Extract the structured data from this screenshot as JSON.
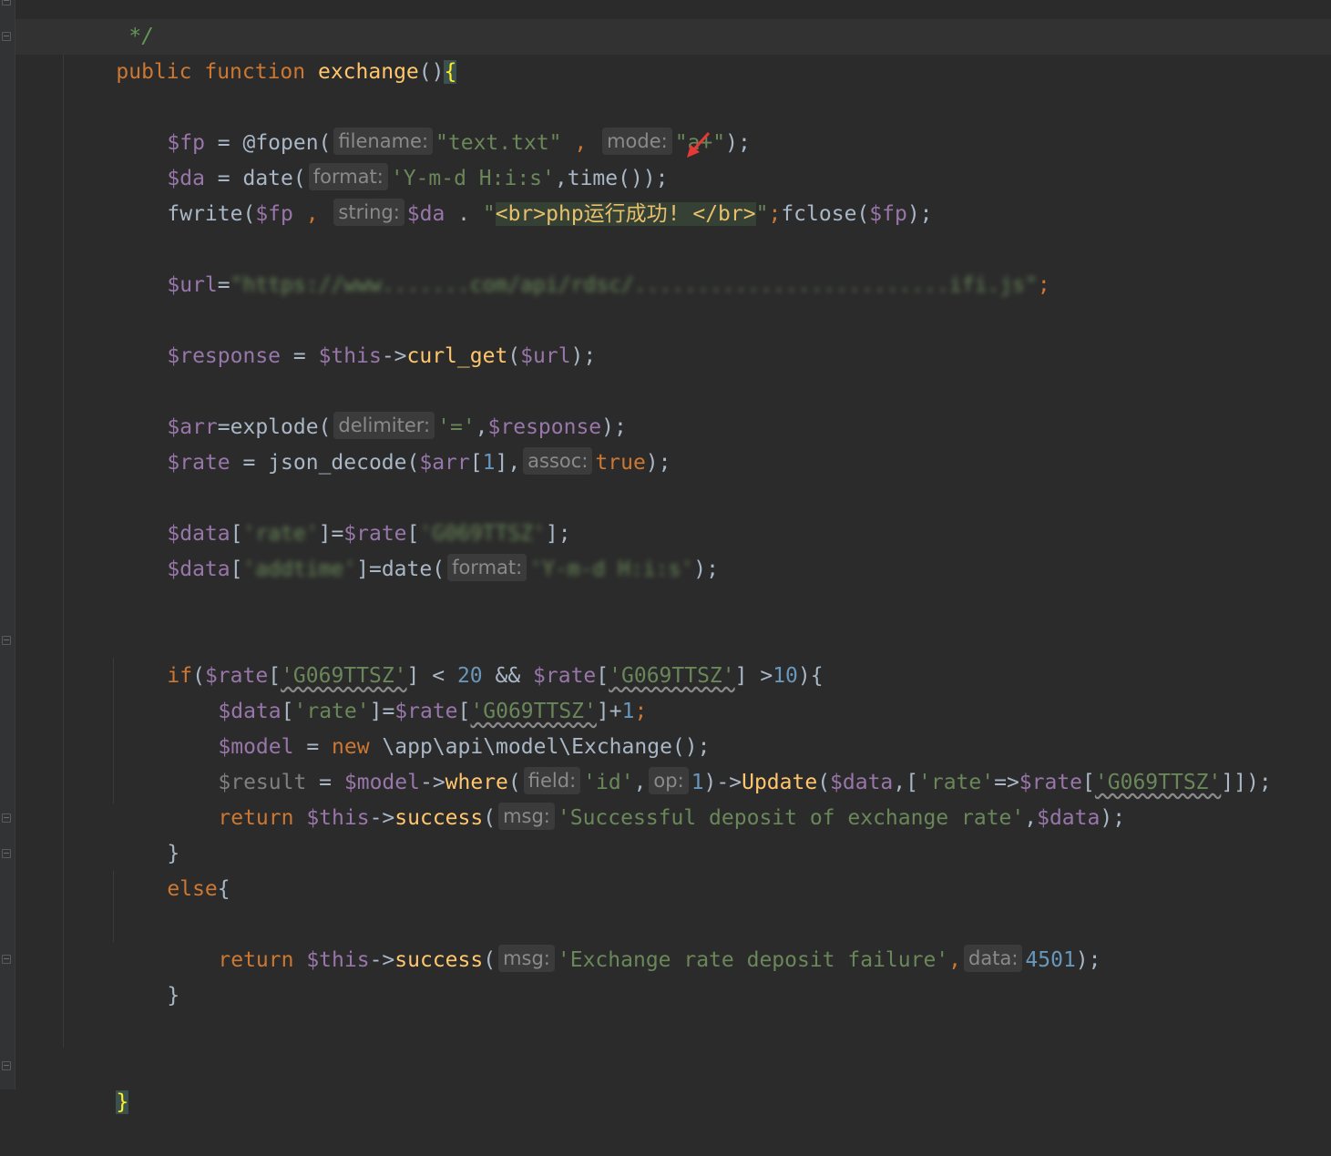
{
  "comment_tail": "*/",
  "func": {
    "kw1": "public",
    "kw2": "function",
    "name": "exchange",
    "open": "(){",
    "close": "}"
  },
  "hints": {
    "filename": "filename:",
    "mode": "mode:",
    "format": "format:",
    "string": "string:",
    "delimiter": "delimiter:",
    "assoc": "assoc:",
    "field": "field:",
    "op": "op:",
    "msg": "msg:",
    "data": "data:"
  },
  "l_fopen": {
    "var": "$fp",
    "eq": " = @fopen(",
    "a1": "\"text.txt\"",
    "sep": " , ",
    "a2": "\"a+\"",
    "end": ");"
  },
  "l_date": {
    "var": "$da",
    "eq": " = date(",
    "a1": "'Y-m-d H:i:s'",
    "mid": ",time());"
  },
  "l_fwrite": {
    "fn": "fwrite(",
    "v1": "$fp",
    "sep": " , ",
    "v2": "$da",
    "dot": " . ",
    "q1": "\"",
    "html": "<br>php运行成功! </br>",
    "q2": "\"",
    "end": ");fclose(",
    "v3": "$fp",
    "end2": ");"
  },
  "l_url": {
    "var": "$url",
    "eq": "=",
    "str": "\"https://www.......com/api/rdsc/.........................ifi.js\"",
    "end": ";"
  },
  "l_response": {
    "var": "$response",
    "eq": " = ",
    "this": "$this",
    "arrow": "->",
    "fn": "curl_get",
    "open": "(",
    "arg": "$url",
    "end": ");"
  },
  "l_explode": {
    "var": "$arr",
    "eq": "=explode(",
    "a1": "'='",
    "comma": ",",
    "a2": "$response",
    "end": ");"
  },
  "l_json": {
    "var": "$rate",
    "eq": " = json_decode(",
    "a1": "$arr",
    "idx": "[",
    "num": "1",
    "idx2": "],",
    "val": "true",
    "end": ");"
  },
  "l_data1": {
    "var": "$data",
    "open": "[",
    "key": "'rate'",
    "mid": "]=",
    "var2": "$rate",
    "open2": "[",
    "key2": "'G069TTSZ'",
    "end": "];"
  },
  "l_data2": {
    "var": "$data",
    "open": "[",
    "key": "'addtime'",
    "mid": "]=date(",
    "arg": "'Y-m-d H:i:s'",
    "end": ");"
  },
  "l_if": {
    "kw": "if",
    "p1": "(",
    "v1": "$rate",
    "b1": "[",
    "k1": "'G069TTSZ'",
    "b2": "]",
    "op1": " < ",
    "n1": "20",
    "and": " && ",
    "v2": "$rate",
    "b3": "[",
    "k2": "'G069TTSZ'",
    "b4": "]",
    "op2": " >",
    "n2": "10",
    "end": "){"
  },
  "l_set": {
    "var": "$data",
    "b1": "[",
    "k1": "'rate'",
    "mid": "]=",
    "var2": "$rate",
    "b2": "[",
    "k2": "'G069TTSZ'",
    "end": "]+",
    "num": "1",
    "semi": ";"
  },
  "l_model": {
    "var": "$model",
    "eq": " = ",
    "kw": "new",
    "cls": " \\app\\api\\model\\Exchange();"
  },
  "l_result": {
    "var": "$result",
    "eq": " = ",
    "var2": "$model",
    "arrow": "->",
    "fn": "where",
    "open": "(",
    "a1": "'id'",
    "comma": ",",
    "num": "1",
    "mid": ")->",
    "fn2": "Update",
    "open2": "(",
    "v3": "$data",
    "c2": ",[",
    "k": "'rate'",
    "arr": "=>",
    "v4": "$rate",
    "b": "[",
    "k2": "'G069TTSZ'",
    "end": "]]);"
  },
  "l_return1": {
    "kw": "return",
    "this": " $this",
    "arrow": "->",
    "fn": "success",
    "open": "(",
    "str": "'Successful deposit of exchange rate'",
    "comma": ",",
    "v": "$data",
    "end": ");"
  },
  "l_close_if": "}",
  "l_else": {
    "kw": "else",
    "brace": "{"
  },
  "l_return2": {
    "kw": "return",
    "this": " $this",
    "arrow": "->",
    "fn": "success",
    "open": "(",
    "str": "'Exchange rate deposit failure'",
    "comma": ",",
    "num": "4501",
    "end": ");"
  },
  "l_close_else": "}"
}
